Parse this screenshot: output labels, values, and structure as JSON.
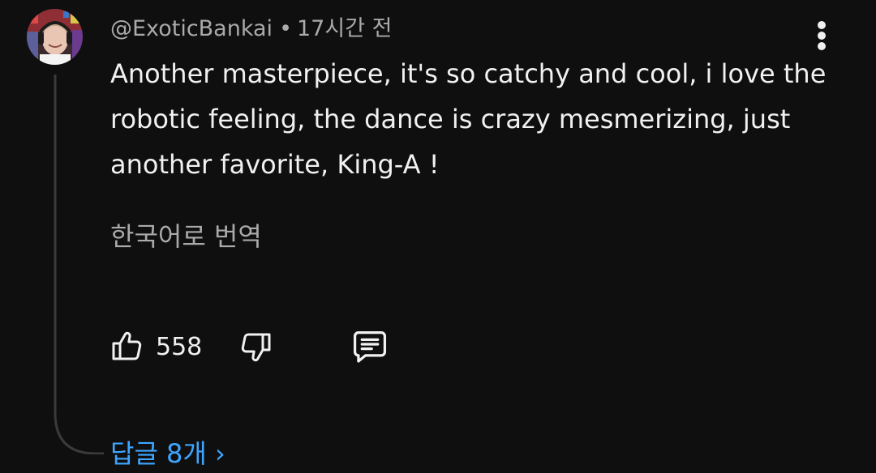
{
  "comment": {
    "author": "@ExoticBankai",
    "separator": "•",
    "time": "17시간 전",
    "text": "Another masterpiece, it's so catchy and cool, i love the robotic feeling, the dance is crazy mesmerizing, just another favorite, King-A !",
    "translate_label": "한국어로 번역",
    "like_count": "558",
    "replies_label": "답글 8개 ›"
  },
  "icons": {
    "more": "more-vert-icon",
    "like": "thumb-up-icon",
    "dislike": "thumb-down-icon",
    "reply": "comment-icon"
  },
  "colors": {
    "background": "#0f0f0f",
    "primary_text": "#f1f1f1",
    "secondary_text": "#aaaaaa",
    "link": "#3ea6ff",
    "thread_line": "#3a3a3a"
  }
}
